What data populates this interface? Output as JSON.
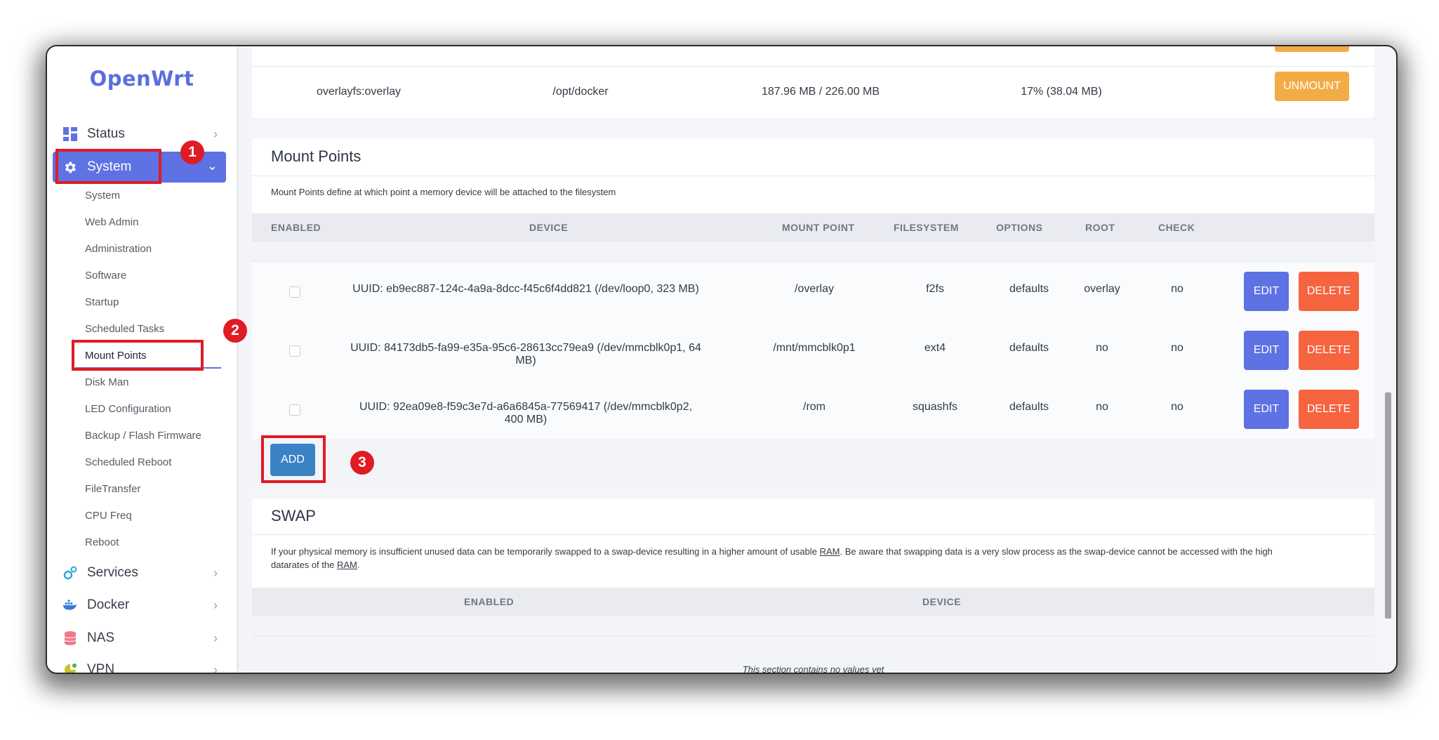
{
  "brand": {
    "logo": "OpenWrt"
  },
  "sidebar": {
    "menu": [
      {
        "label": "Status",
        "icon": "dashboard-icon"
      },
      {
        "label": "System",
        "icon": "gear-icon"
      },
      {
        "label": "Services",
        "icon": "services-icon"
      },
      {
        "label": "Docker",
        "icon": "docker-icon"
      },
      {
        "label": "NAS",
        "icon": "database-icon"
      },
      {
        "label": "VPN",
        "icon": "vpn-icon"
      }
    ],
    "system_items": [
      "System",
      "Web Admin",
      "Administration",
      "Software",
      "Startup",
      "Scheduled Tasks",
      "Mount Points",
      "Disk Man",
      "LED Configuration",
      "Backup / Flash Firmware",
      "Scheduled Reboot",
      "FileTransfer",
      "CPU Freq",
      "Reboot"
    ]
  },
  "mounted_fs": {
    "row": {
      "device": "overlayfs:overlay",
      "mount_point": "/opt/docker",
      "available": "187.96 MB / 226.00 MB",
      "used": "17% (38.04 MB)",
      "button": "UNMOUNT"
    }
  },
  "mount_points": {
    "title": "Mount Points",
    "description": "Mount Points define at which point a memory device will be attached to the filesystem",
    "headers": [
      "ENABLED",
      "DEVICE",
      "MOUNT POINT",
      "FILESYSTEM",
      "OPTIONS",
      "ROOT",
      "CHECK"
    ],
    "rows": [
      {
        "device": "UUID: eb9ec887-124c-4a9a-8dcc-f45c6f4dd821 (/dev/loop0, 323 MB)",
        "mount_point": "/overlay",
        "filesystem": "f2fs",
        "options": "defaults",
        "root": "overlay",
        "check": "no"
      },
      {
        "device": "UUID: 84173db5-fa99-e35a-95c6-28613cc79ea9 (/dev/mmcblk0p1, 64 MB)",
        "mount_point": "/mnt/mmcblk0p1",
        "filesystem": "ext4",
        "options": "defaults",
        "root": "no",
        "check": "no"
      },
      {
        "device": "UUID: 92ea09e8-f59c3e7d-a6a6845a-77569417 (/dev/mmcblk0p2, 400 MB)",
        "mount_point": "/rom",
        "filesystem": "squashfs",
        "options": "defaults",
        "root": "no",
        "check": "no"
      }
    ],
    "edit_label": "EDIT",
    "delete_label": "DELETE",
    "add_label": "ADD"
  },
  "swap": {
    "title": "SWAP",
    "description_line1_pre": "If your physical memory is insufficient unused data can be temporarily swapped to a swap-device resulting in a higher amount of usable ",
    "description_ram": "RAM",
    "description_line1_post": ". Be aware that swapping data is a very slow process as the swap-device cannot be accessed with the high",
    "description_line2_pre": "datarates of the ",
    "description_line2_post": ".",
    "headers": [
      "ENABLED",
      "DEVICE"
    ],
    "empty_text": "This section contains no values yet"
  },
  "annotations": [
    "1",
    "2",
    "3"
  ]
}
